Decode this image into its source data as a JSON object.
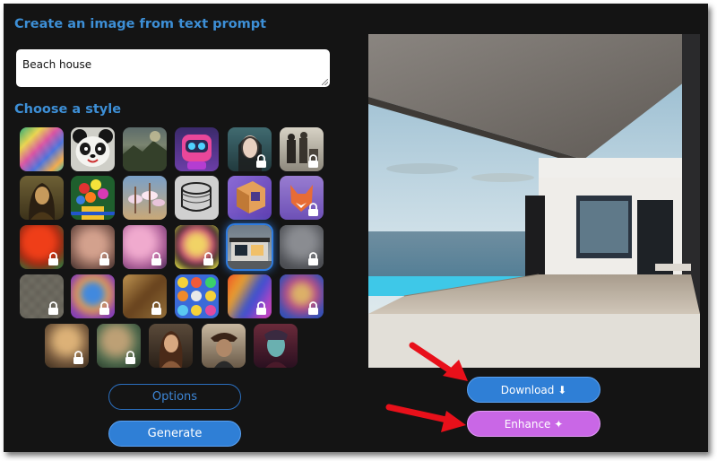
{
  "heading": "Create an image from text prompt",
  "prompt": {
    "value": "Beach house"
  },
  "style_heading": "Choose a style",
  "styles": {
    "row1": [
      "abstract-paint",
      "panda",
      "landscape",
      "robot",
      "portrait-girl-locked",
      "vintage-photo-locked"
    ],
    "row2": [
      "mona-lisa",
      "flowers",
      "ballet",
      "ink-sketch",
      "isometric-room",
      "fox-locked"
    ],
    "row3": [
      "red-figure-locked",
      "portrait-locked",
      "pink-abstract-locked",
      "pop-art-locked",
      "modern-house-selected",
      "gray-locked"
    ],
    "row4": [
      "mosaic-locked",
      "cartoon-cat-locked",
      "brown-abstract-locked",
      "emoji-icons",
      "colorful-wave-locked",
      "painting-locked"
    ],
    "row5": [
      "woman-portrait-locked",
      "forest-locked",
      "renaissance-portrait",
      "pirate",
      "elf-man"
    ]
  },
  "buttons": {
    "options": "Options",
    "generate": "Generate",
    "download": "Download ⬇",
    "enhance": "Enhance ✦"
  },
  "colors": {
    "accent": "#3d8fd6",
    "generate": "#2f7fd6",
    "enhance": "#c967e6",
    "arrow": "#e8101a",
    "background": "#141414"
  }
}
